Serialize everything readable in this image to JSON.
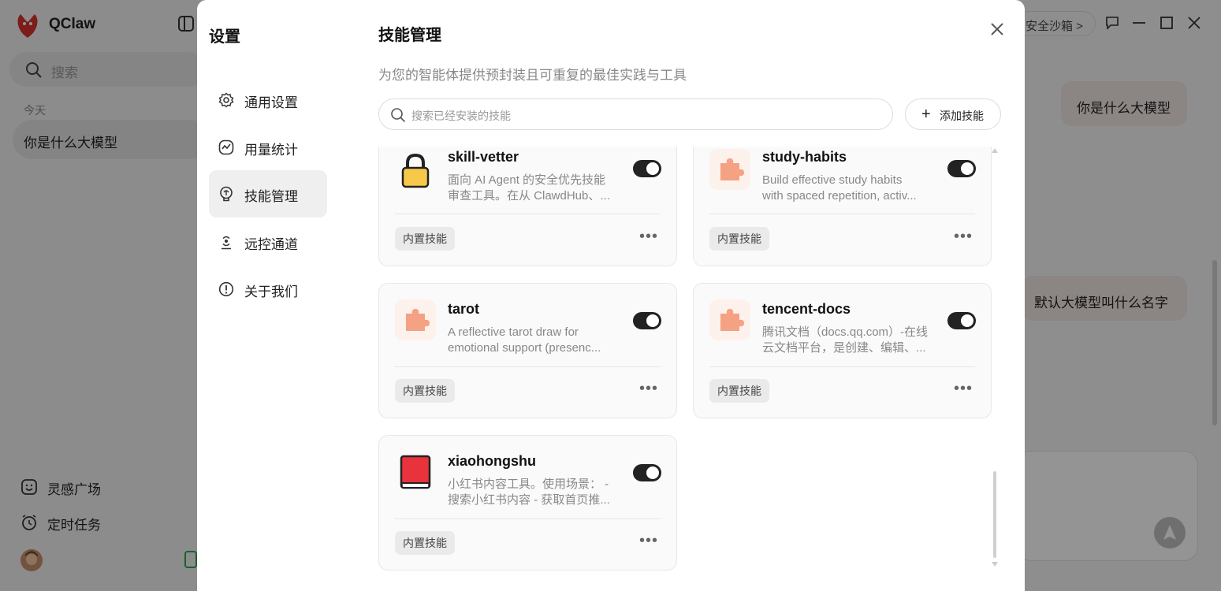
{
  "app": {
    "name": "QClaw",
    "search_placeholder": "搜索",
    "day_label": "今天",
    "conversation": "你是什么大模型",
    "bottom_nav": [
      "灵感广场",
      "定时任务"
    ],
    "sandbox_label": "安全沙箱 >"
  },
  "chat": {
    "messages": [
      "你是什么大模型",
      "默认大模型叫什么名字"
    ]
  },
  "settings": {
    "title": "设置",
    "nav": [
      {
        "label": "通用设置",
        "icon": "gear-icon"
      },
      {
        "label": "用量统计",
        "icon": "chart-icon"
      },
      {
        "label": "技能管理",
        "icon": "brain-icon",
        "active": true
      },
      {
        "label": "远控通道",
        "icon": "signal-icon"
      },
      {
        "label": "关于我们",
        "icon": "info-icon"
      }
    ]
  },
  "skills": {
    "title": "技能管理",
    "subtitle": "为您的智能体提供预封装且可重复的最佳实践与工具",
    "search_placeholder": "搜索已经安装的技能",
    "add_label": "添加技能",
    "badge_label": "内置技能",
    "more_label": "•••",
    "cards": [
      {
        "name": "skill-vetter",
        "desc1": "面向 AI Agent 的安全优先技能",
        "desc2": "审查工具。在从 ClawdHub、...",
        "icon": "lock-icon",
        "enabled": true
      },
      {
        "name": "study-habits",
        "desc1": "Build effective study habits",
        "desc2": "with spaced repetition, activ...",
        "icon": "puzzle-icon",
        "enabled": true
      },
      {
        "name": "tarot",
        "desc1": "A reflective tarot draw for",
        "desc2": "emotional support (presenc...",
        "icon": "puzzle-icon",
        "enabled": true
      },
      {
        "name": "tencent-docs",
        "desc1": "腾讯文档（docs.qq.com）-在线",
        "desc2": "云文档平台，是创建、编辑、...",
        "icon": "puzzle-icon",
        "enabled": true
      },
      {
        "name": "xiaohongshu",
        "desc1": "小红书内容工具。使用场景： -",
        "desc2": "搜索小红书内容 - 获取首页推...",
        "icon": "book-icon",
        "enabled": true
      }
    ]
  },
  "colors": {
    "accent_dark": "#222222",
    "puzzle_orange": "#f4a184",
    "book_red": "#e8323c",
    "lock_yellow": "#f7c84a"
  }
}
